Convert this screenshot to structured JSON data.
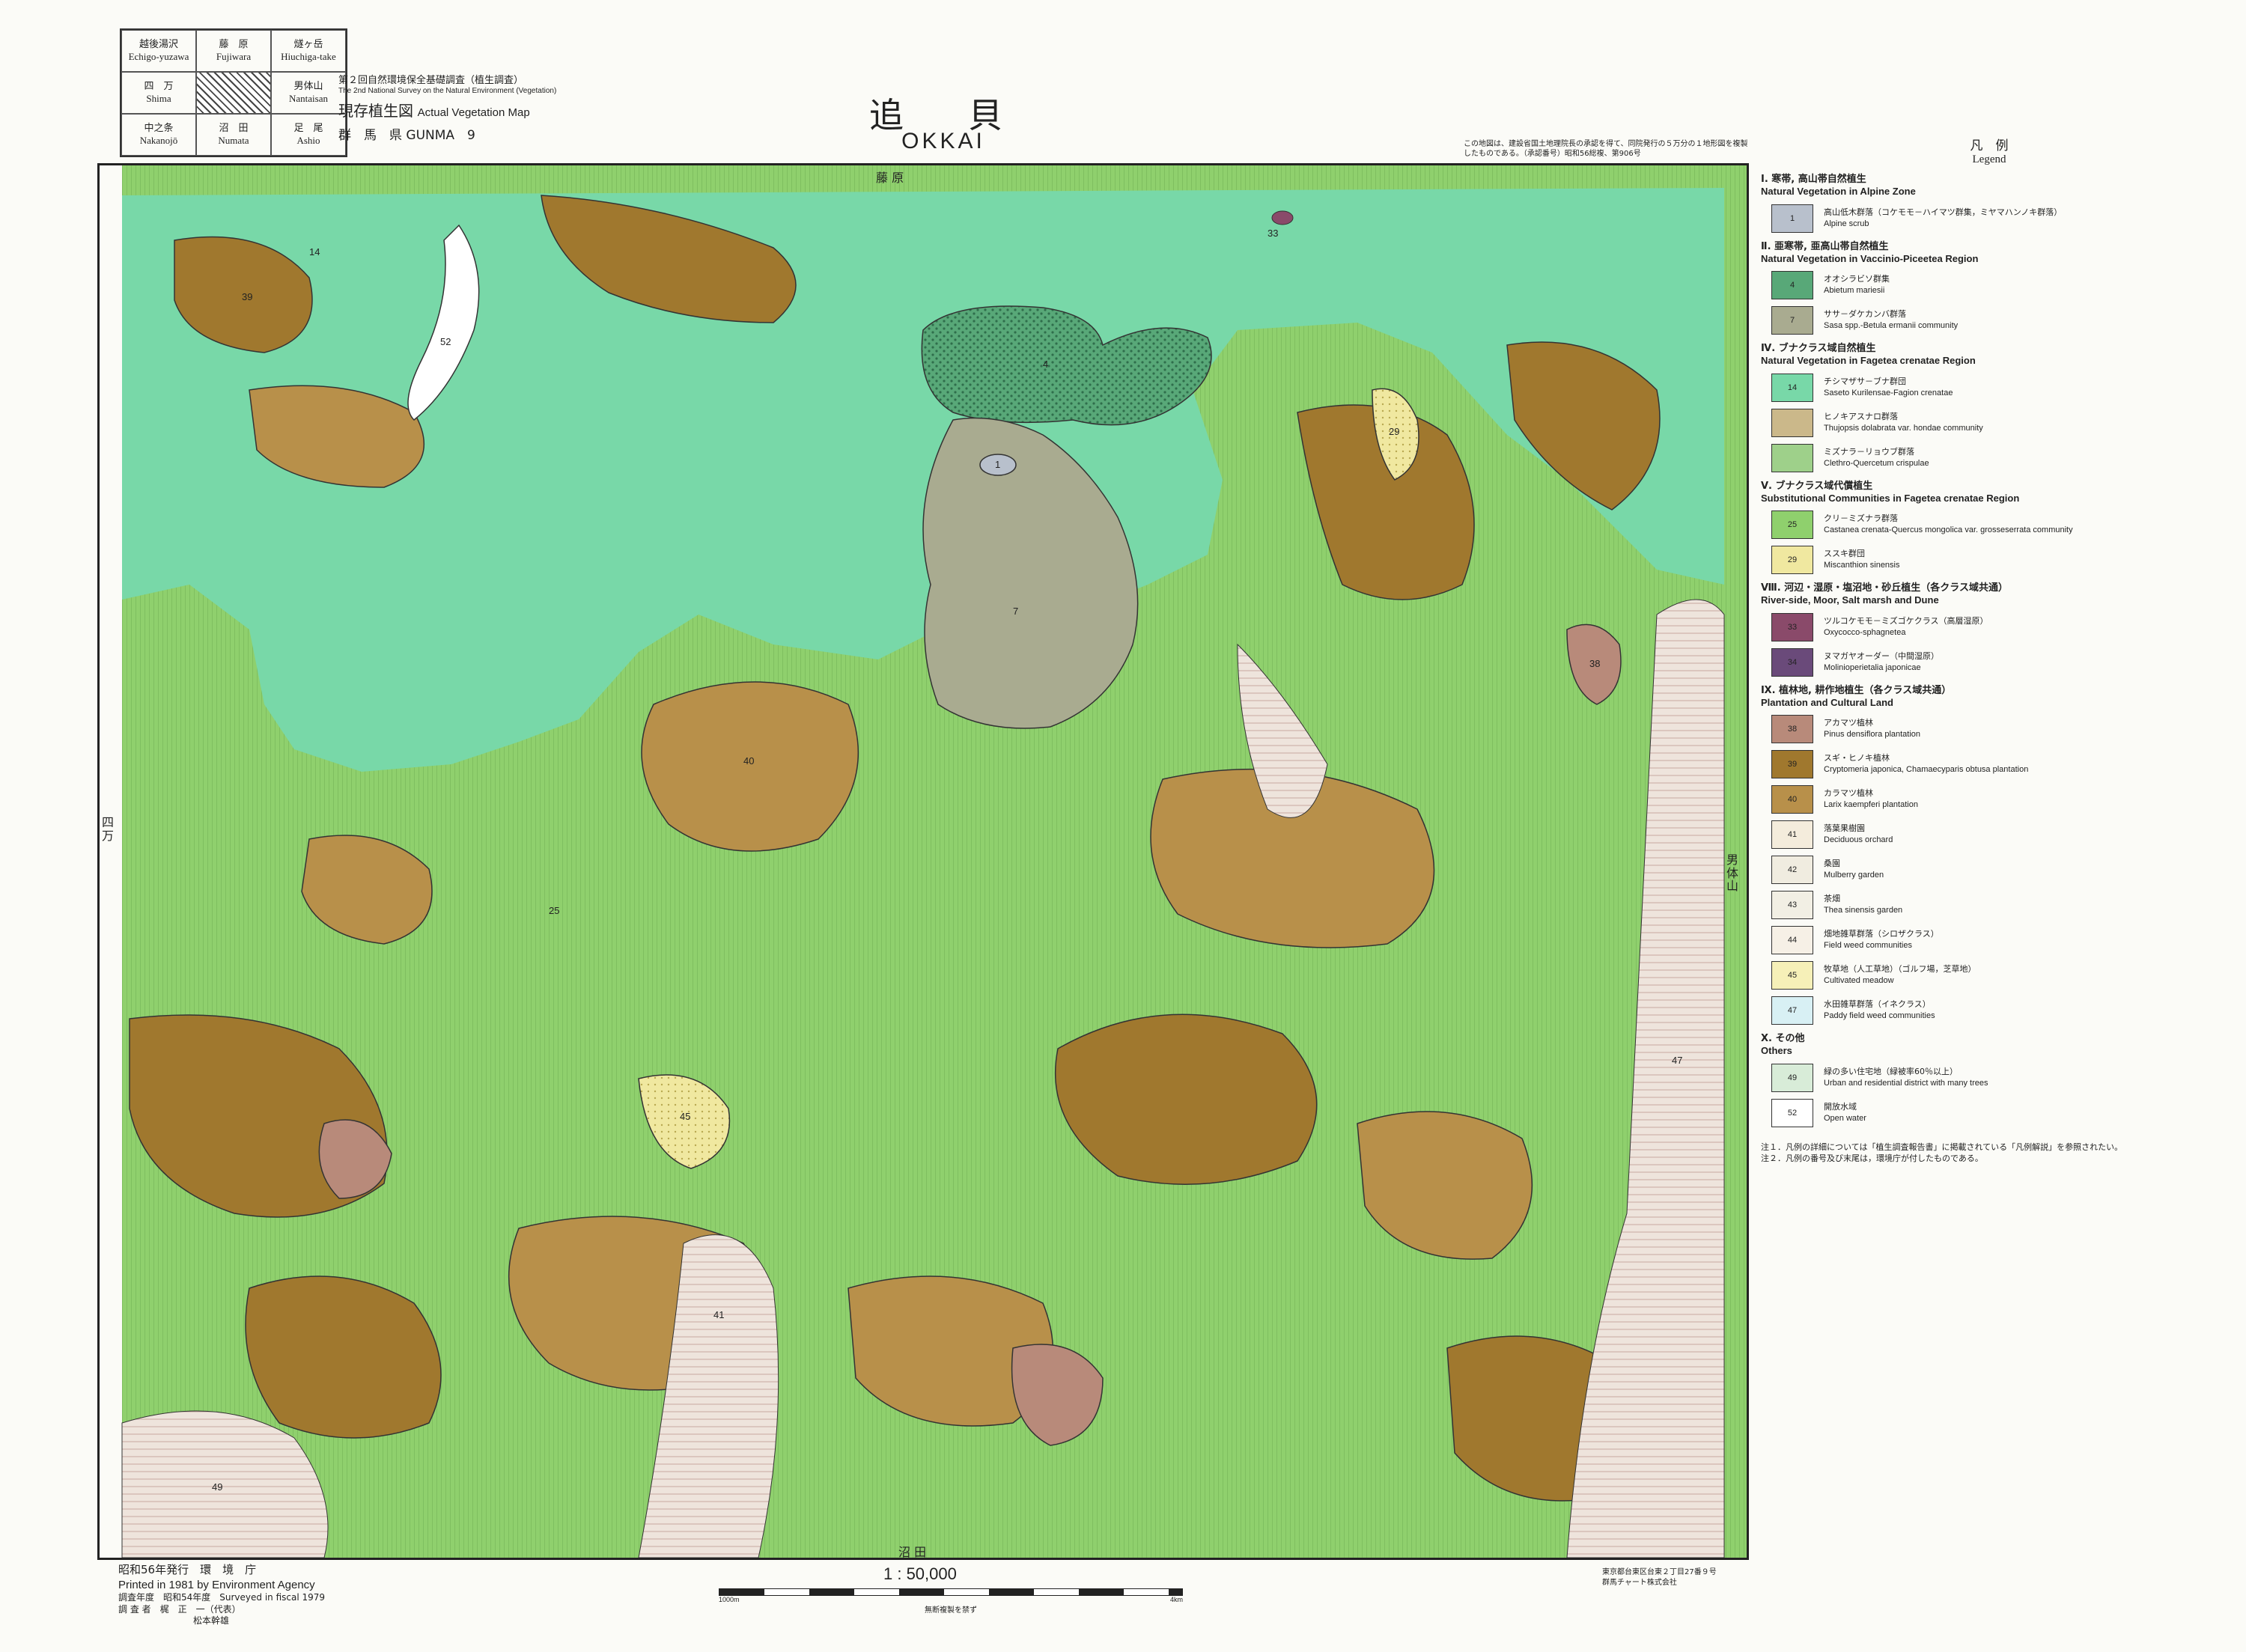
{
  "index_grid": [
    {
      "jp": "越後湯沢",
      "en": "Echigo-yuzawa"
    },
    {
      "jp": "藤　原",
      "en": "Fujiwara"
    },
    {
      "jp": "燧ヶ岳",
      "en": "Hiuchiga-take"
    },
    {
      "jp": "四　万",
      "en": "Shima"
    },
    {
      "jp": "",
      "en": ""
    },
    {
      "jp": "男体山",
      "en": "Nantaisan"
    },
    {
      "jp": "中之条",
      "en": "Nakanojō"
    },
    {
      "jp": "沼　田",
      "en": "Numata"
    },
    {
      "jp": "足　尾",
      "en": "Ashio"
    }
  ],
  "header": {
    "survey_jp": "第２回自然環境保全基礎調査（植生調査）",
    "survey_en": "The 2nd National Survey on the Natural Environment (Vegetation)",
    "map_type_jp": "現存植生図",
    "map_type_en": "Actual Vegetation Map",
    "prefecture": "群　馬　県 GUNMA　9",
    "title_jp": "追　貝",
    "title_en": "OKKAI",
    "note": "この地図は、建設省国土地理院長の承認を得て、同院発行の５万分の１地形図を複製したものである。（承認番号）昭和56総複、第906号"
  },
  "map_edge_labels": {
    "top": "藤 原",
    "bottom": "沼 田",
    "left": "四 万",
    "right": "男体山"
  },
  "legend": {
    "title_jp": "凡　例",
    "title_en": "Legend",
    "sections": [
      {
        "head_jp": "Ⅰ. 寒帯, 高山帯自然植生",
        "head_en": "Natural Vegetation in Alpine Zone",
        "items": [
          {
            "code": "1",
            "color": "#b8c0cc",
            "jp": "高山低木群落（コケモモ－ハイマツ群集，ミヤマハンノキ群落）",
            "en": "Alpine scrub"
          }
        ]
      },
      {
        "head_jp": "Ⅱ. 亜寒帯, 亜高山帯自然植生",
        "head_en": "Natural Vegetation in Vaccinio-Piceetea Region",
        "items": [
          {
            "code": "4",
            "color": "#58a878",
            "jp": "オオシラビソ群集",
            "en": "Abietum mariesii"
          },
          {
            "code": "7",
            "color": "#a9ab90",
            "jp": "ササ－ダケカンバ群落",
            "en": "Sasa spp.-Betula ermanii community"
          }
        ]
      },
      {
        "head_jp": "Ⅳ. ブナクラス域自然植生",
        "head_en": "Natural Vegetation in Fagetea crenatae Region",
        "items": [
          {
            "code": "14",
            "color": "#78d8a8",
            "jp": "チシマザサ－ブナ群団",
            "en": "Saseto Kurilensae-Fagion crenatae"
          },
          {
            "code": "",
            "color": "#cbb88a",
            "jp": "ヒノキアスナロ群落",
            "en": "Thujopsis dolabrata var. hondae community"
          },
          {
            "code": "",
            "color": "#9ed08a",
            "jp": "ミズナラ－リョウブ群落",
            "en": "Clethro-Quercetum crispulae"
          }
        ]
      },
      {
        "head_jp": "Ⅴ. ブナクラス域代償植生",
        "head_en": "Substitutional Communities in Fagetea crenatae Region",
        "items": [
          {
            "code": "25",
            "color": "#8fd06d",
            "jp": "クリ－ミズナラ群落",
            "en": "Castanea crenata-Quercus mongolica var. grosseserrata community"
          },
          {
            "code": "29",
            "color": "#f0e8a0",
            "jp": "ススキ群団",
            "en": "Miscanthion sinensis"
          }
        ]
      },
      {
        "head_jp": "Ⅷ. 河辺・湿原・塩沼地・砂丘植生（各クラス域共通）",
        "head_en": "River-side, Moor, Salt marsh and Dune",
        "items": [
          {
            "code": "33",
            "color": "#8a4a6a",
            "jp": "ツルコケモモ－ミズゴケクラス（高層湿原）",
            "en": "Oxycocco-sphagnetea"
          },
          {
            "code": "34",
            "color": "#6a4a7a",
            "jp": "ヌマガヤオーダー（中間湿原）",
            "en": "Molinioperietalia japonicae"
          }
        ]
      },
      {
        "head_jp": "Ⅸ. 植林地, 耕作地植生（各クラス域共通）",
        "head_en": "Plantation and Cultural Land",
        "items": [
          {
            "code": "38",
            "color": "#b88a7a",
            "jp": "アカマツ植林",
            "en": "Pinus densiflora plantation"
          },
          {
            "code": "39",
            "color": "#a0782e",
            "jp": "スギ・ヒノキ植林",
            "en": "Cryptomeria japonica, Chamaecyparis obtusa plantation"
          },
          {
            "code": "40",
            "color": "#b8904a",
            "jp": "カラマツ植林",
            "en": "Larix kaempferi plantation"
          },
          {
            "code": "41",
            "color": "#f4ecdc",
            "jp": "落葉果樹園",
            "en": "Deciduous orchard"
          },
          {
            "code": "42",
            "color": "#f0ece0",
            "jp": "桑園",
            "en": "Mulberry garden"
          },
          {
            "code": "43",
            "color": "#f2efe4",
            "jp": "茶畑",
            "en": "Thea sinensis garden"
          },
          {
            "code": "44",
            "color": "#f6f0e6",
            "jp": "畑地雑草群落（シロザクラス）",
            "en": "Field weed communities"
          },
          {
            "code": "45",
            "color": "#f6f0b8",
            "jp": "牧草地（人工草地）（ゴルフ場，芝草地）",
            "en": "Cultivated meadow"
          },
          {
            "code": "47",
            "color": "#d8f0f4",
            "jp": "水田雑草群落（イネクラス）",
            "en": "Paddy field weed communities"
          }
        ]
      },
      {
        "head_jp": "Ⅹ. その他",
        "head_en": "Others",
        "items": [
          {
            "code": "49",
            "color": "#d8ecd8",
            "jp": "緑の多い住宅地（緑被率60％以上）",
            "en": "Urban and residential district with many trees"
          },
          {
            "code": "52",
            "color": "#ffffff",
            "jp": "開放水域",
            "en": "Open water"
          }
        ]
      }
    ],
    "notes": [
      "注１．凡例の詳細については「植生調査報告書」に掲載されている「凡例解説」を参照されたい。",
      "注２．凡例の番号及び末尾は，環境庁が付したものである。"
    ]
  },
  "footer": {
    "issued_jp": "昭和56年発行",
    "agency_jp": "環　境　庁",
    "printed": "Printed in 1981 by Environment Agency",
    "surveyed": "調査年度　昭和54年度　Surveyed in fiscal 1979",
    "surveyors": "調 査 者　梶　正　一（代表）",
    "surveyor2": "松本幹雄",
    "scale": "1 : 50,000",
    "scale_left": "1000m",
    "scale_right": "4km",
    "copy_note": "無断複製を禁ず",
    "printer1": "東京都台東区台東２丁目27番９号",
    "printer2": "群馬チャート株式会社"
  },
  "map_codes": [
    "14",
    "7",
    "1",
    "4",
    "25",
    "39",
    "40",
    "38",
    "41",
    "47",
    "52",
    "29",
    "45",
    "49",
    "33"
  ]
}
